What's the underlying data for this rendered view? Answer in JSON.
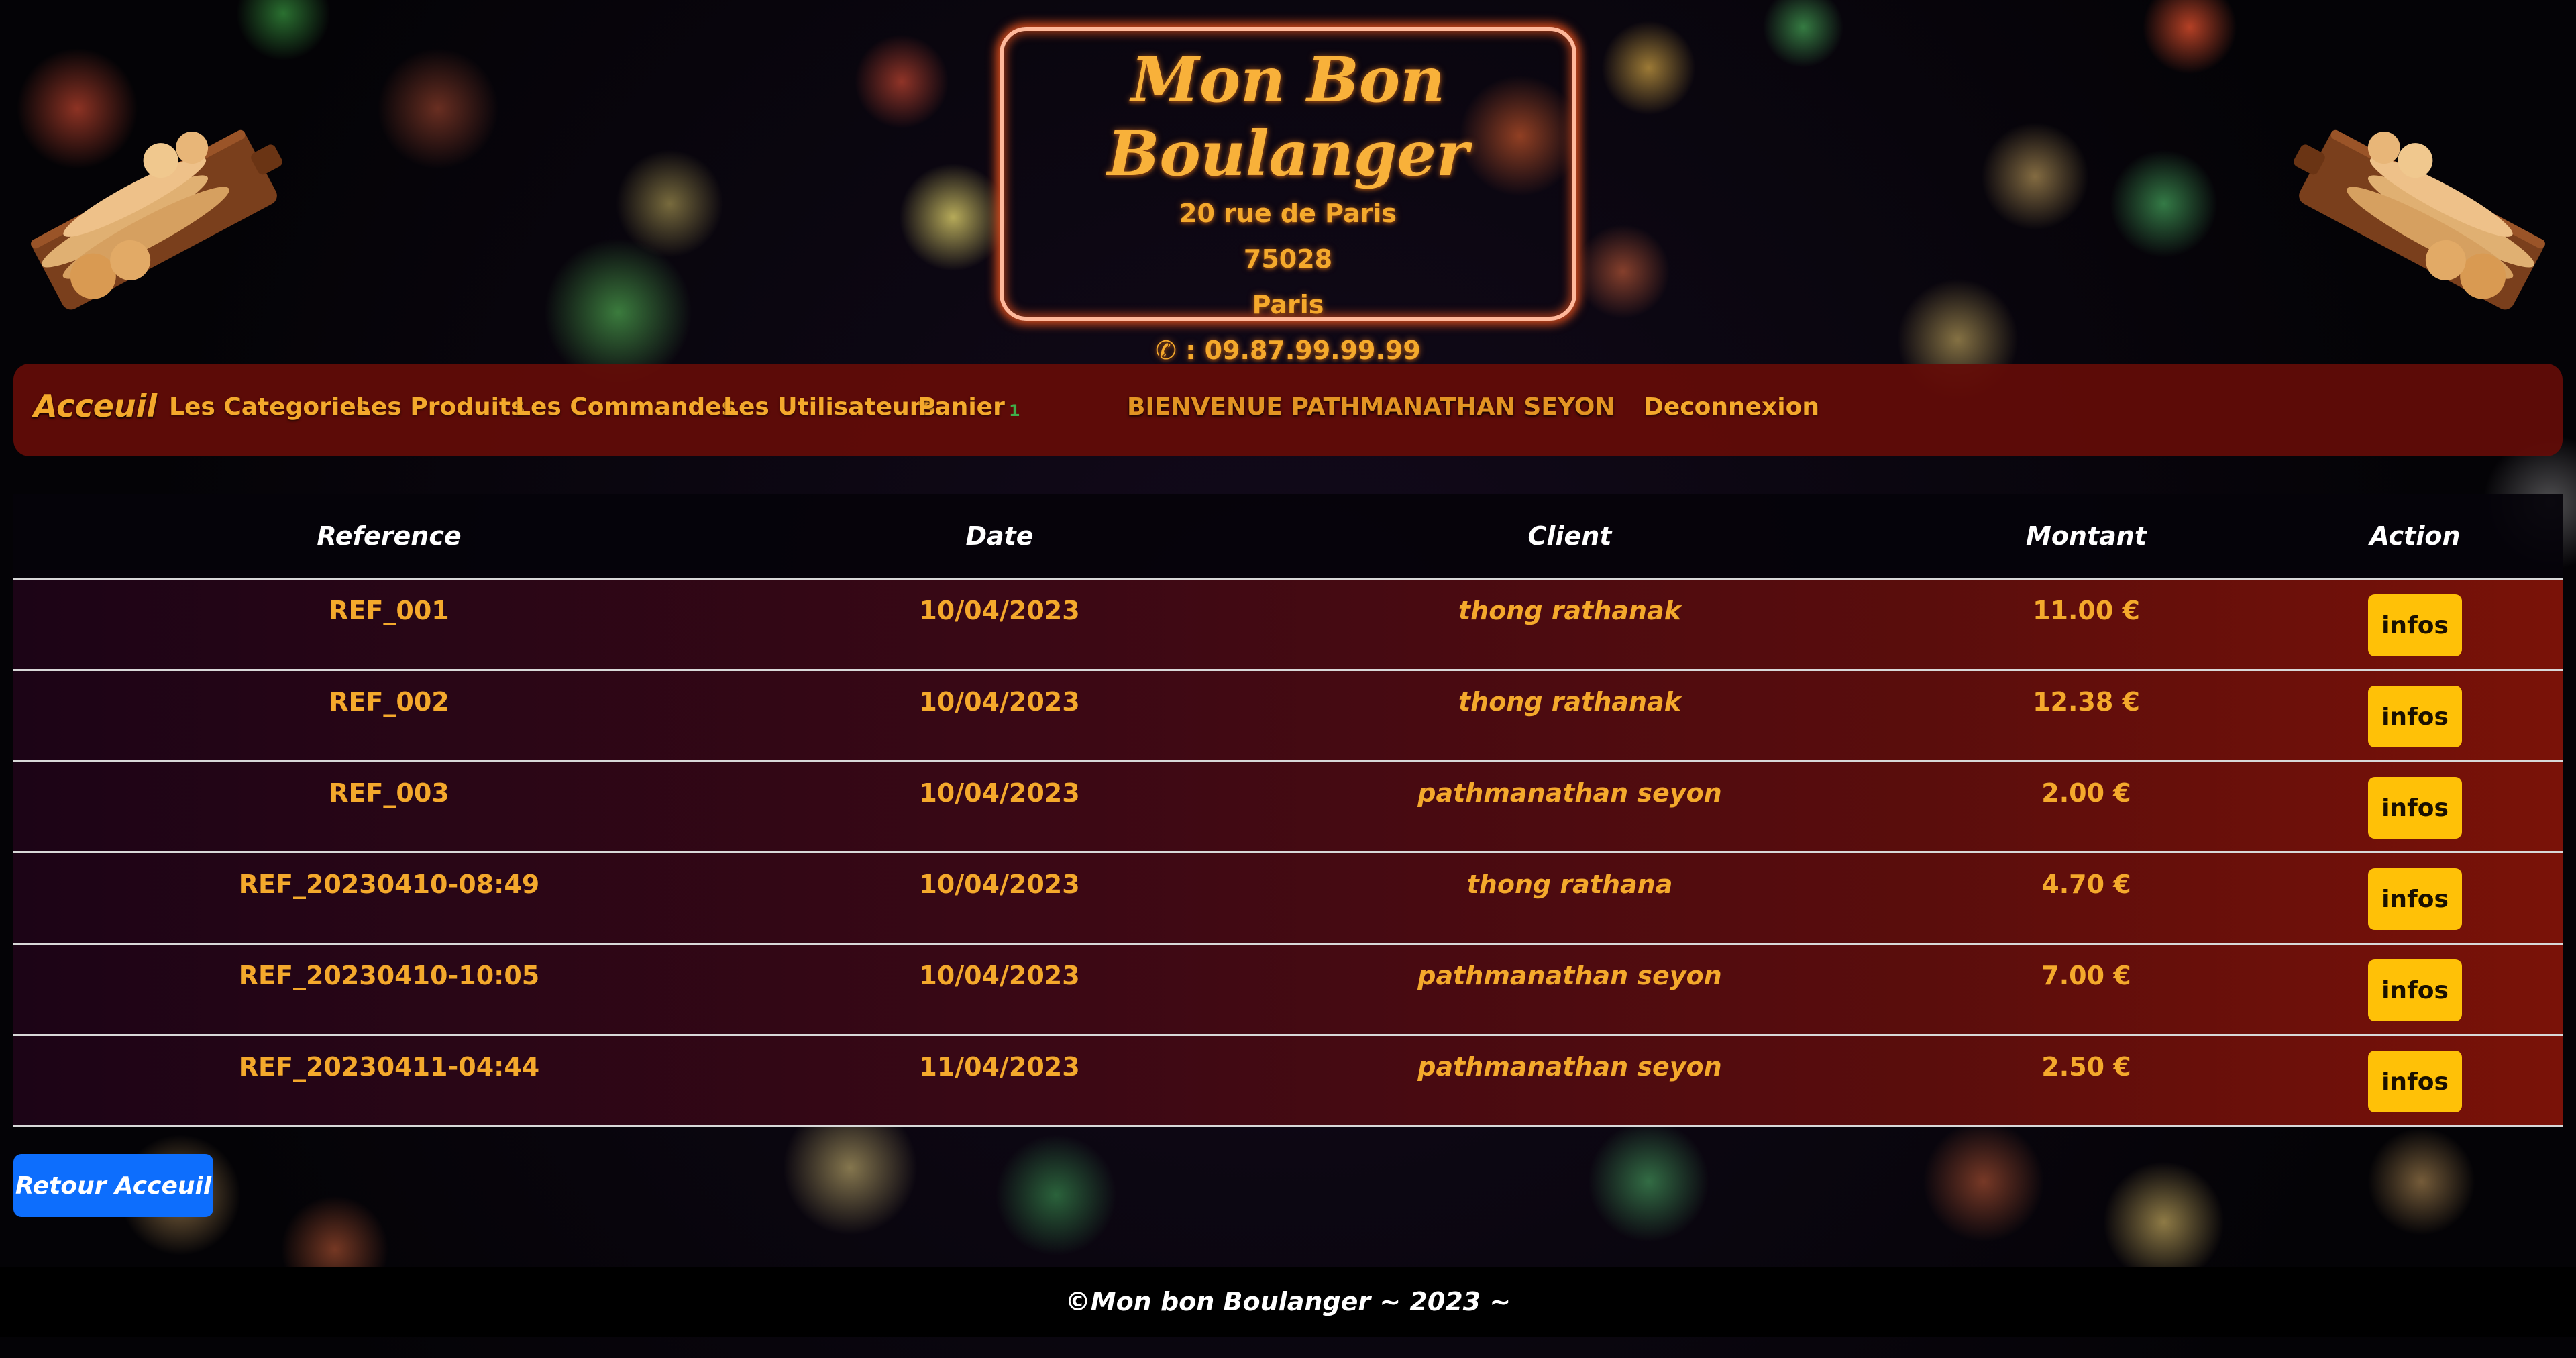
{
  "header": {
    "shop_name": "Mon Bon Boulanger",
    "address": "20 rue de Paris",
    "postcode": "75028",
    "city": "Paris",
    "phone": "✆ : 09.87.99.99.99"
  },
  "nav": {
    "brand": "Acceuil",
    "items": [
      {
        "label": "Les Categories"
      },
      {
        "label": "Les Produits"
      },
      {
        "label": "Les Commandes"
      },
      {
        "label": "Les Utilisateurs"
      },
      {
        "label": "Panier"
      }
    ],
    "cart_count": "1",
    "welcome": "BIENVENUE PATHMANATHAN SEYON",
    "logout": "Deconnexion"
  },
  "table": {
    "headers": [
      "Reference",
      "Date",
      "Client",
      "Montant",
      "Action"
    ],
    "rows": [
      {
        "reference": "REF_001",
        "date": "10/04/2023",
        "client": "thong rathanak",
        "montant": "11.00 €",
        "action": "infos"
      },
      {
        "reference": "REF_002",
        "date": "10/04/2023",
        "client": "thong rathanak",
        "montant": "12.38 €",
        "action": "infos"
      },
      {
        "reference": "REF_003",
        "date": "10/04/2023",
        "client": "pathmanathan seyon",
        "montant": "2.00 €",
        "action": "infos"
      },
      {
        "reference": "REF_20230410-08:49",
        "date": "10/04/2023",
        "client": "thong rathana",
        "montant": "4.70 €",
        "action": "infos"
      },
      {
        "reference": "REF_20230410-10:05",
        "date": "10/04/2023",
        "client": "pathmanathan seyon",
        "montant": "7.00 €",
        "action": "infos"
      },
      {
        "reference": "REF_20230411-04:44",
        "date": "11/04/2023",
        "client": "pathmanathan seyon",
        "montant": "2.50 €",
        "action": "infos"
      }
    ]
  },
  "back_button": "Retour Acceuil",
  "footer": "©Mon bon Boulanger ~ 2023 ~",
  "colors": {
    "accent_orange": "#f4a92c",
    "nav_bg": "#640c08",
    "infos_button": "#ffc107",
    "back_button": "#0d6efd"
  },
  "icons": {
    "phone": "phone-icon",
    "decor": "bread-board-icon"
  }
}
